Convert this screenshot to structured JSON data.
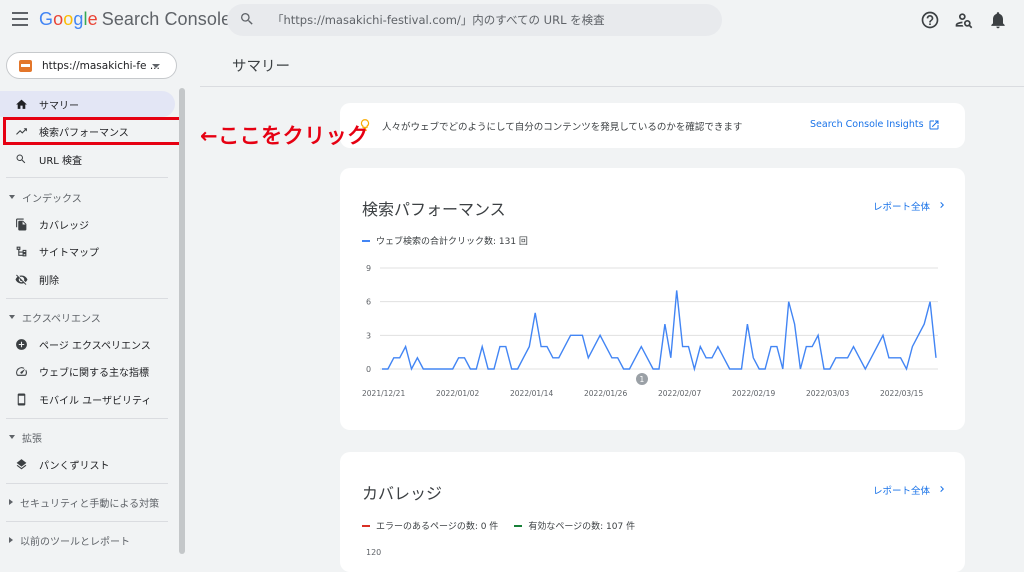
{
  "app": {
    "logo": {
      "google": "Google",
      "product": "Search Console"
    },
    "search_placeholder": "「https://masakichi-festival.com/」内のすべての URL を検査"
  },
  "sidebar": {
    "property": "https://masakichi-fe ...",
    "items": [
      {
        "label": "サマリー",
        "icon": "home-icon"
      },
      {
        "label": "検索パフォーマンス",
        "icon": "trending-up-icon"
      },
      {
        "label": "URL 検査",
        "icon": "search-icon"
      }
    ],
    "sections": [
      {
        "title": "インデックス",
        "expanded": true,
        "items": [
          {
            "label": "カバレッジ",
            "icon": "file-copy-icon"
          },
          {
            "label": "サイトマップ",
            "icon": "sitemap-icon"
          },
          {
            "label": "削除",
            "icon": "visibility-off-icon"
          }
        ]
      },
      {
        "title": "エクスペリエンス",
        "expanded": true,
        "items": [
          {
            "label": "ページ エクスペリエンス",
            "icon": "add-circle-icon"
          },
          {
            "label": "ウェブに関する主な指標",
            "icon": "speed-gauge-icon"
          },
          {
            "label": "モバイル ユーザビリティ",
            "icon": "smartphone-icon"
          }
        ]
      },
      {
        "title": "拡張",
        "expanded": true,
        "items": [
          {
            "label": "パンくずリスト",
            "icon": "layers-icon"
          }
        ]
      },
      {
        "title": "セキュリティと手動による対策",
        "expanded": false,
        "items": []
      },
      {
        "title": "以前のツールとレポート",
        "expanded": false,
        "items": []
      }
    ]
  },
  "main": {
    "page_title": "サマリー",
    "annotation": "←ここをクリック",
    "insights": {
      "message": "人々がウェブでどのようにして自分のコンテンツを発見しているのかを確認できます",
      "link": "Search Console Insights"
    },
    "performance": {
      "title": "検索パフォーマンス",
      "report_link": "レポート全体",
      "legend": "ウェブ検索の合計クリック数: 131 回",
      "event_marker": "1"
    },
    "coverage": {
      "title": "カバレッジ",
      "report_link": "レポート全体",
      "legend_error": "エラーのあるページの数: 0 件",
      "legend_valid": "有効なページの数: 107 件",
      "first_tick": "120"
    }
  },
  "colors": {
    "series": "#4285f4",
    "error": "#d93025",
    "valid": "#188038",
    "link": "#1a73e8",
    "annotation": "#e60012"
  },
  "chart_data": {
    "type": "line",
    "title": "",
    "xlabel": "",
    "ylabel": "",
    "ylim": [
      0,
      9
    ],
    "yticks": [
      0,
      3,
      6,
      9
    ],
    "x_tick_labels": [
      "2021/12/21",
      "2022/01/02",
      "2022/01/14",
      "2022/01/26",
      "2022/02/07",
      "2022/02/19",
      "2022/03/03",
      "2022/03/15"
    ],
    "grid": true,
    "series": [
      {
        "name": "",
        "values": [
          0,
          0,
          1,
          1,
          2,
          0,
          1,
          0,
          0,
          0,
          0,
          0,
          0,
          1,
          1,
          0,
          0,
          2,
          0,
          0,
          2,
          2,
          0,
          0,
          1,
          2,
          5,
          2,
          2,
          1,
          1,
          2,
          3,
          3,
          3,
          1,
          2,
          3,
          2,
          1,
          1,
          0,
          0,
          1,
          2,
          1,
          0,
          0,
          4,
          1,
          7,
          2,
          2,
          0,
          2,
          1,
          1,
          2,
          1,
          0,
          0,
          0,
          4,
          1,
          0,
          0,
          2,
          2,
          0,
          6,
          4,
          0,
          2,
          2,
          3,
          0,
          0,
          1,
          1,
          1,
          2,
          1,
          0,
          1,
          2,
          3,
          1,
          1,
          1,
          0,
          2,
          3,
          4,
          6,
          1
        ],
        "start_date": "2021/12/21"
      }
    ]
  }
}
